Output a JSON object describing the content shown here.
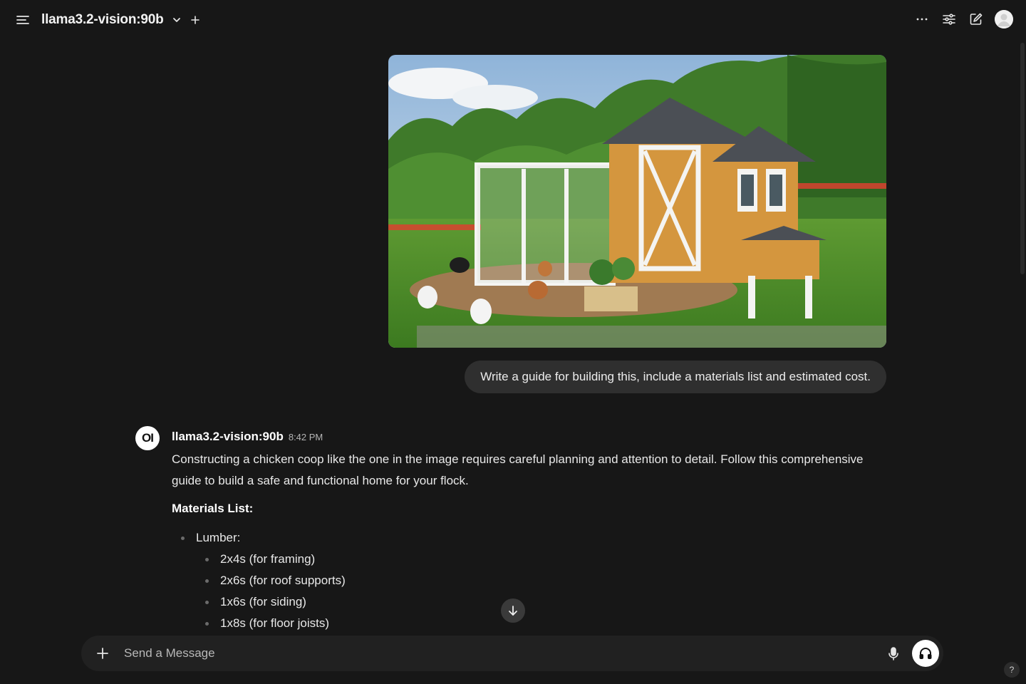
{
  "header": {
    "model_title": "llama3.2-vision:90b"
  },
  "user_message": {
    "text": "Write a guide for building this, include a materials list and estimated cost."
  },
  "assistant_message": {
    "logo_text": "OI",
    "name": "llama3.2-vision:90b",
    "time": "8:42 PM",
    "intro": "Constructing a chicken coop like the one in the image requires careful planning and attention to detail. Follow this comprehensive guide to build a safe and functional home for your flock.",
    "materials_heading": "Materials List:",
    "materials": [
      {
        "label": "Lumber:",
        "items": [
          "2x4s (for framing)",
          "2x6s (for roof supports)",
          "1x6s (for siding)",
          "1x8s (for floor joists)"
        ]
      }
    ]
  },
  "composer": {
    "placeholder": "Send a Message"
  },
  "help": {
    "label": "?"
  },
  "colors": {
    "background": "#171717",
    "bubble": "#2f2f2f",
    "composer": "#212121",
    "coop_wood": "#d4963e",
    "coop_trim": "#f4f4f2",
    "roof": "#4b4f55"
  }
}
